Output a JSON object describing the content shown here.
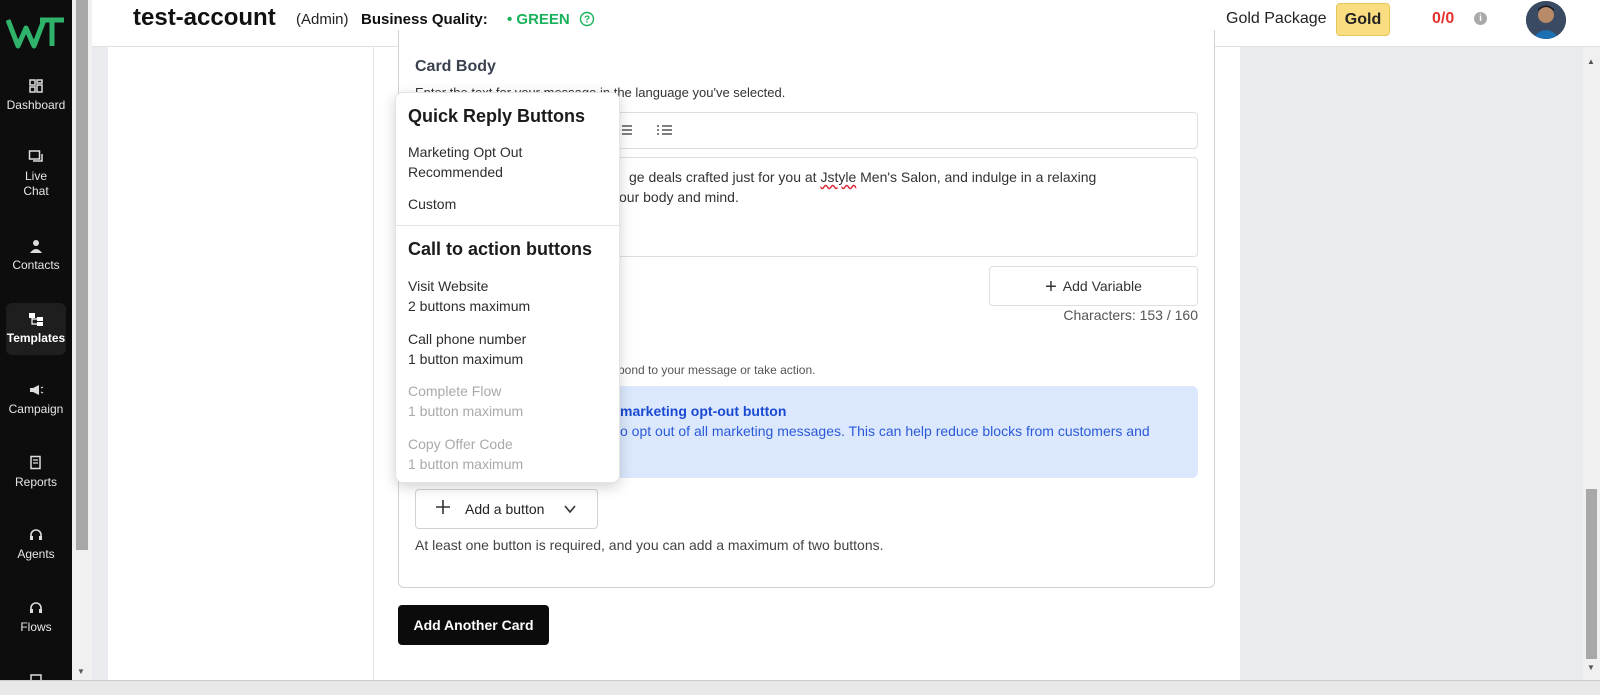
{
  "sidebar": {
    "items": [
      {
        "label": "Dashboard"
      },
      {
        "label": "Live\nChat"
      },
      {
        "label": "Contacts"
      },
      {
        "label": "Templates"
      },
      {
        "label": "Campaign"
      },
      {
        "label": "Reports"
      },
      {
        "label": "Agents"
      },
      {
        "label": "Flows"
      }
    ]
  },
  "header": {
    "account": "test-account",
    "role": "(Admin)",
    "business_quality_label": "Business Quality:",
    "business_quality_status": "• GREEN",
    "package_label": "Gold Package",
    "package_badge": "Gold",
    "credits": "0/0"
  },
  "card": {
    "body_title": "Card Body",
    "body_description": "Enter the text for your message in the language you've selected.",
    "editor_line1": "ge deals crafted just for you at ",
    "editor_brand": "Jstyle",
    "editor_line1_rest": " Men's Salon, and indulge in a relaxing",
    "editor_line2": "our body and mind.",
    "add_variable": "Add Variable",
    "char_count": "Characters: 153 / 160",
    "buttons_description": "spond to your message or take action.",
    "optout_title": "marketing opt-out button",
    "optout_text": "o opt out of all marketing messages. This can help reduce blocks from customers and",
    "add_button": "Add a button",
    "requirement": "At least one button is required, and you can add a maximum of two buttons.",
    "add_another_card": "Add Another Card"
  },
  "dropdown": {
    "quick_reply_header": "Quick Reply Buttons",
    "marketing_opt_out": "Marketing Opt Out",
    "marketing_opt_out_sub": "Recommended",
    "custom": "Custom",
    "cta_header": "Call to action buttons",
    "visit_website": "Visit Website",
    "visit_website_sub": "2 buttons maximum",
    "call_phone": "Call phone number",
    "call_phone_sub": "1 button maximum",
    "complete_flow": "Complete Flow",
    "complete_flow_sub": "1 button maximum",
    "copy_offer": "Copy Offer Code",
    "copy_offer_sub": "1 button maximum"
  },
  "colors": {
    "sidebar_bg": "#0d0d0d",
    "status_green": "#19b25a",
    "credits_red": "#e5322e",
    "gold_badge": "#f9dd80",
    "optout_bg": "#dbe8fd",
    "optout_text": "#1a4ad1",
    "logo_green": "#2fb36b"
  }
}
